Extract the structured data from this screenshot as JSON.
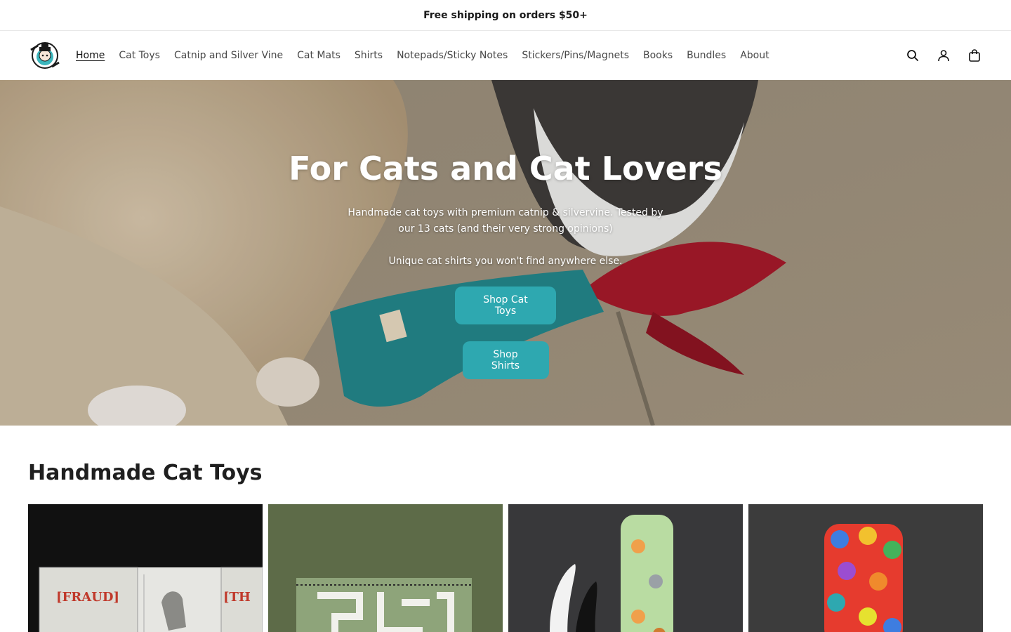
{
  "announcement": {
    "text": "Free shipping on orders $50+"
  },
  "header": {
    "logo_alt": "MEOW MOB",
    "nav": [
      {
        "label": "Home",
        "active": true
      },
      {
        "label": "Cat Toys"
      },
      {
        "label": "Catnip and Silver Vine"
      },
      {
        "label": "Cat Mats"
      },
      {
        "label": "Shirts"
      },
      {
        "label": "Notepads/Sticky Notes"
      },
      {
        "label": "Stickers/Pins/Magnets"
      },
      {
        "label": "Books"
      },
      {
        "label": "Bundles"
      },
      {
        "label": "About"
      }
    ],
    "icons": [
      "search-icon",
      "account-icon",
      "cart-icon"
    ]
  },
  "hero": {
    "title": "For Cats and Cat Lovers",
    "text": "Handmade cat toys with premium catnip & silvervine. Tested by our 13 cats (and their very strong opinions)",
    "text2": "Unique cat shirts you won't find anywhere else.",
    "button_primary": "Shop Cat Toys",
    "button_secondary": "Shop Shirts",
    "button_color": "#2ea8b0"
  },
  "collection": {
    "title": "Handmade Cat Toys",
    "products": [
      {
        "image_text": [
          "[FRAUD]",
          "[TH"
        ],
        "image": "fraud-print-toy"
      },
      {
        "image": "green-maze-toy"
      },
      {
        "image": "cat-print-kicker-toy"
      },
      {
        "image": "rainbow-cat-toy"
      }
    ]
  }
}
